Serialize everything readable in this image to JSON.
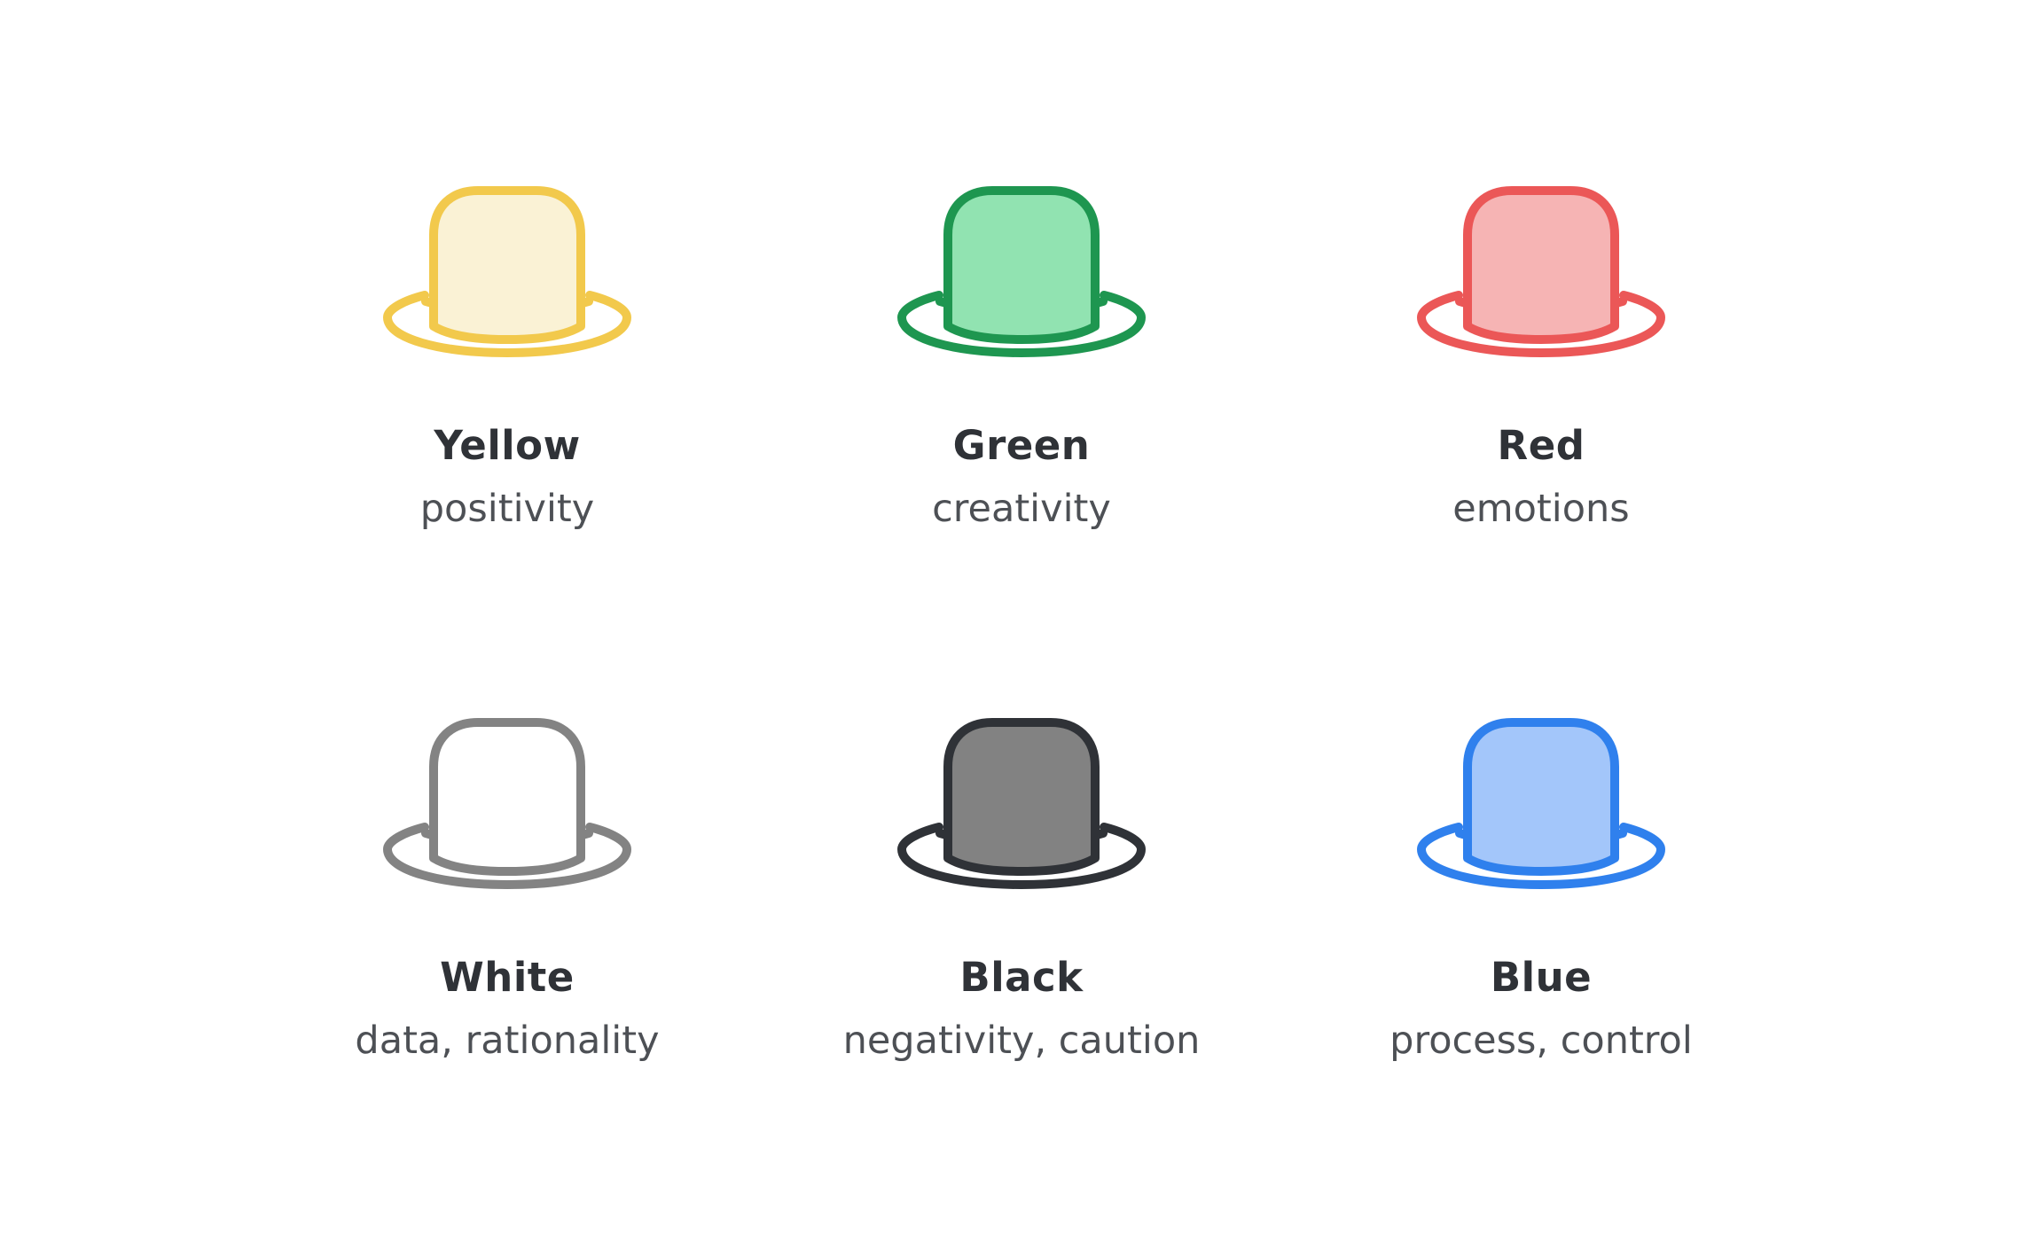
{
  "hats": [
    {
      "name": "Yellow",
      "description": "positivity",
      "stroke": "#F2C94C",
      "fill": "#FAF2D5"
    },
    {
      "name": "Green",
      "description": "creativity",
      "stroke": "#1E9650",
      "fill": "#91E3B1"
    },
    {
      "name": "Red",
      "description": "emotions",
      "stroke": "#EB5757",
      "fill": "#F6B4B4"
    },
    {
      "name": "White",
      "description": "data, rationality",
      "stroke": "#838383",
      "fill": "#FFFFFF"
    },
    {
      "name": "Black",
      "description": "negativity, caution",
      "stroke": "#2F3237",
      "fill": "#828282"
    },
    {
      "name": "Blue",
      "description": "process, control",
      "stroke": "#2F80ED",
      "fill": "#A3C6FA"
    }
  ]
}
